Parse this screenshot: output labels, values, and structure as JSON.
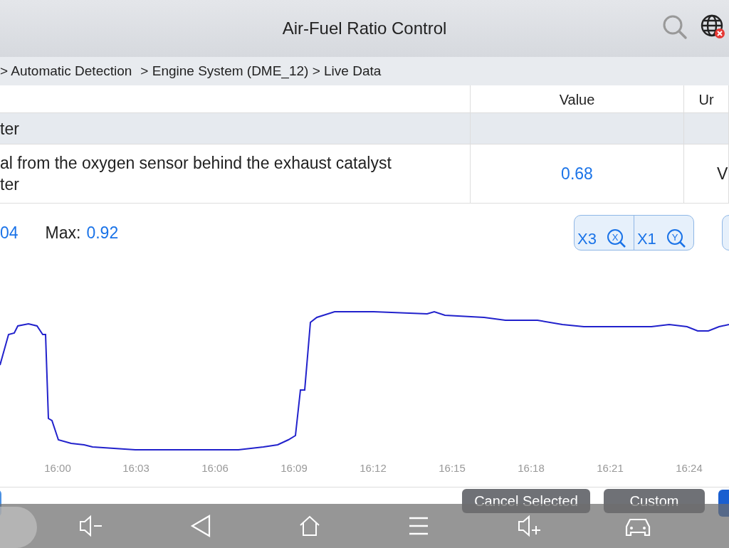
{
  "header": {
    "title": "Air-Fuel Ratio Control"
  },
  "breadcrumb": [
    "> Automatic Detection",
    "> Engine System (DME_12) > Live Data"
  ],
  "table": {
    "columns": [
      "Value",
      "Ur"
    ],
    "rows": [
      {
        "name": "ter",
        "selected": true
      },
      {
        "name": "al from the oxygen sensor behind the exhaust catalyst\nter",
        "value": "0.68",
        "unit": "V",
        "selected": false
      }
    ]
  },
  "stats": {
    "min_value": "04",
    "max_label": "Max:",
    "max_value": "0.92"
  },
  "zoom_buttons": [
    {
      "label": "X3",
      "axis": "X"
    },
    {
      "label": "X1",
      "axis": "Y"
    }
  ],
  "x_ticks": [
    "16:00",
    "16:03",
    "16:06",
    "16:09",
    "16:12",
    "16:15",
    "16:18",
    "16:21",
    "16:24"
  ],
  "actions": [
    {
      "label": "Cancel Selected",
      "disabled": true
    },
    {
      "label": "Custom",
      "disabled": true
    }
  ]
}
